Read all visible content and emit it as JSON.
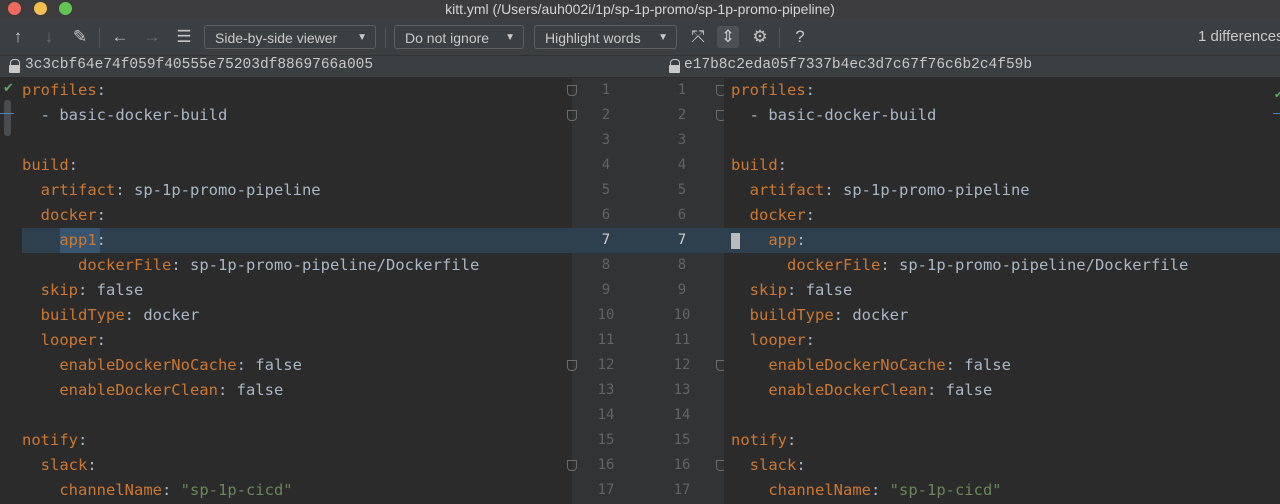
{
  "window": {
    "title": "kitt.yml (/Users/auh002i/1p/sp-1p-promo/sp-1p-promo-pipeline)"
  },
  "toolbar": {
    "viewer_combo": "Side-by-side viewer",
    "ignore_combo": "Do not ignore",
    "highlight_combo": "Highlight words",
    "help_label": "?",
    "diff_count": "1 differences"
  },
  "left": {
    "hash": "3c3cbf64e74f059f40555e75203df8869766a005",
    "lines": [
      [
        [
          "key",
          "profiles"
        ],
        [
          "plain",
          ":"
        ]
      ],
      [
        [
          "plain",
          "  - basic-docker-build"
        ]
      ],
      [],
      [
        [
          "key",
          "build"
        ],
        [
          "plain",
          ":"
        ]
      ],
      [
        [
          "plain",
          "  "
        ],
        [
          "key",
          "artifact"
        ],
        [
          "plain",
          ": sp-1p-promo-pipeline"
        ]
      ],
      [
        [
          "plain",
          "  "
        ],
        [
          "key",
          "docker"
        ],
        [
          "plain",
          ":"
        ]
      ],
      [
        [
          "plain",
          "    "
        ],
        [
          "key",
          "app1"
        ],
        [
          "plain",
          ":"
        ]
      ],
      [
        [
          "plain",
          "      "
        ],
        [
          "key",
          "dockerFile"
        ],
        [
          "plain",
          ": sp-1p-promo-pipeline/Dockerfile"
        ]
      ],
      [
        [
          "plain",
          "  "
        ],
        [
          "key",
          "skip"
        ],
        [
          "plain",
          ": false"
        ]
      ],
      [
        [
          "plain",
          "  "
        ],
        [
          "key",
          "buildType"
        ],
        [
          "plain",
          ": docker"
        ]
      ],
      [
        [
          "plain",
          "  "
        ],
        [
          "key",
          "looper"
        ],
        [
          "plain",
          ":"
        ]
      ],
      [
        [
          "plain",
          "    "
        ],
        [
          "key",
          "enableDockerNoCache"
        ],
        [
          "plain",
          ": false"
        ]
      ],
      [
        [
          "plain",
          "    "
        ],
        [
          "key",
          "enableDockerClean"
        ],
        [
          "plain",
          ": false"
        ]
      ],
      [],
      [
        [
          "key",
          "notify"
        ],
        [
          "plain",
          ":"
        ]
      ],
      [
        [
          "plain",
          "  "
        ],
        [
          "key",
          "slack"
        ],
        [
          "plain",
          ":"
        ]
      ],
      [
        [
          "plain",
          "    "
        ],
        [
          "key",
          "channelName"
        ],
        [
          "plain",
          ": "
        ],
        [
          "str",
          "\"sp-1p-cicd\""
        ]
      ]
    ]
  },
  "right": {
    "hash": "e17b8c2eda05f7337b4ec3d7c67f76c6b2c4f59b",
    "lines": [
      [
        [
          "key",
          "profiles"
        ],
        [
          "plain",
          ":"
        ]
      ],
      [
        [
          "plain",
          "  - basic-docker-build"
        ]
      ],
      [],
      [
        [
          "key",
          "build"
        ],
        [
          "plain",
          ":"
        ]
      ],
      [
        [
          "plain",
          "  "
        ],
        [
          "key",
          "artifact"
        ],
        [
          "plain",
          ": sp-1p-promo-pipeline"
        ]
      ],
      [
        [
          "plain",
          "  "
        ],
        [
          "key",
          "docker"
        ],
        [
          "plain",
          ":"
        ]
      ],
      [
        [
          "plain",
          "    "
        ],
        [
          "key",
          "app"
        ],
        [
          "plain",
          ":"
        ]
      ],
      [
        [
          "plain",
          "      "
        ],
        [
          "key",
          "dockerFile"
        ],
        [
          "plain",
          ": sp-1p-promo-pipeline/Dockerfile"
        ]
      ],
      [
        [
          "plain",
          "  "
        ],
        [
          "key",
          "skip"
        ],
        [
          "plain",
          ": false"
        ]
      ],
      [
        [
          "plain",
          "  "
        ],
        [
          "key",
          "buildType"
        ],
        [
          "plain",
          ": docker"
        ]
      ],
      [
        [
          "plain",
          "  "
        ],
        [
          "key",
          "looper"
        ],
        [
          "plain",
          ":"
        ]
      ],
      [
        [
          "plain",
          "    "
        ],
        [
          "key",
          "enableDockerNoCache"
        ],
        [
          "plain",
          ": false"
        ]
      ],
      [
        [
          "plain",
          "    "
        ],
        [
          "key",
          "enableDockerClean"
        ],
        [
          "plain",
          ": false"
        ]
      ],
      [],
      [
        [
          "key",
          "notify"
        ],
        [
          "plain",
          ":"
        ]
      ],
      [
        [
          "plain",
          "  "
        ],
        [
          "key",
          "slack"
        ],
        [
          "plain",
          ":"
        ]
      ],
      [
        [
          "plain",
          "    "
        ],
        [
          "key",
          "channelName"
        ],
        [
          "plain",
          ": "
        ],
        [
          "str",
          "\"sp-1p-cicd\""
        ]
      ]
    ]
  },
  "line_numbers": [
    "1",
    "2",
    "3",
    "4",
    "5",
    "6",
    "7",
    "8",
    "9",
    "10",
    "11",
    "12",
    "13",
    "14",
    "15",
    "16",
    "17"
  ],
  "changed_line": "7",
  "fold_lines": [
    "1",
    "2",
    "12",
    "16"
  ],
  "colors": {
    "key": "#cc7832",
    "string": "#6a8759",
    "text": "#a9b7c6",
    "change_bg": "#2e3f4d",
    "close": "#ed6a5e",
    "minimize": "#f5bf4f",
    "zoom": "#61c554"
  }
}
